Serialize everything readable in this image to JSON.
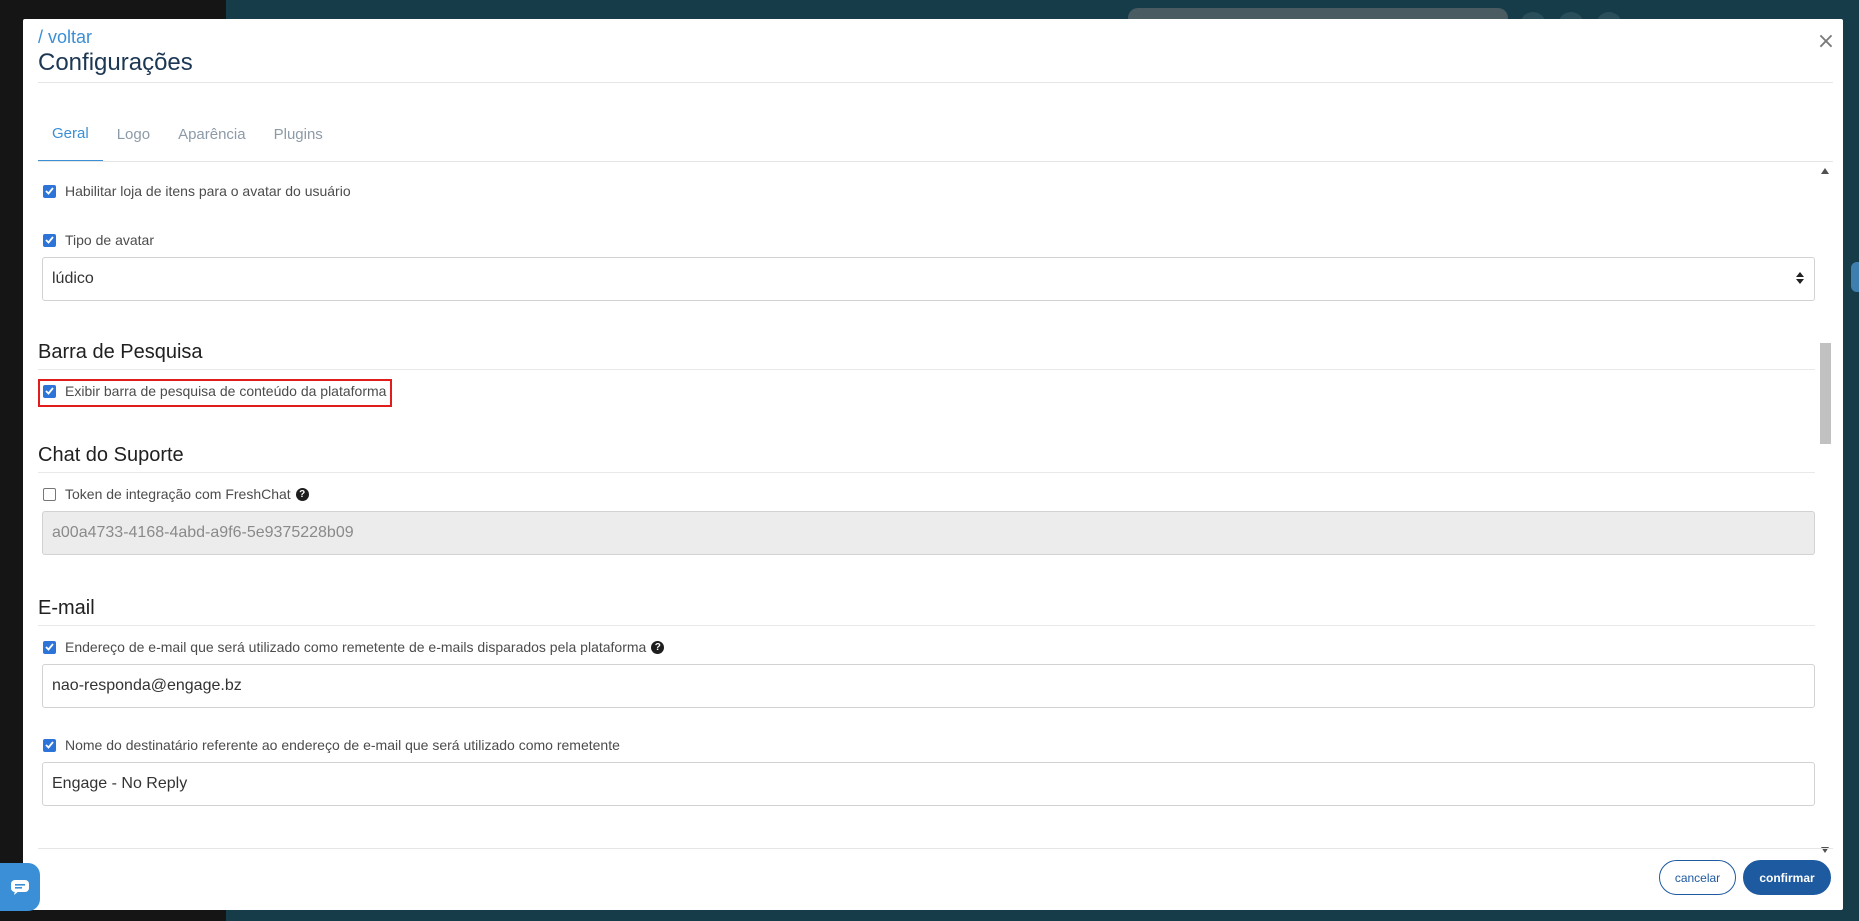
{
  "header": {
    "back_label": "/ voltar",
    "title": "Configurações",
    "close_icon": "×"
  },
  "tabs": [
    {
      "label": "Geral",
      "active": true
    },
    {
      "label": "Logo",
      "active": false
    },
    {
      "label": "Aparência",
      "active": false
    },
    {
      "label": "Plugins",
      "active": false
    }
  ],
  "general": {
    "avatar_store": {
      "label": "Habilitar loja de itens para o avatar do usuário",
      "checked": true
    },
    "avatar_type": {
      "label": "Tipo de avatar",
      "checked": true,
      "value": "lúdico"
    }
  },
  "search_bar": {
    "title": "Barra de Pesquisa",
    "show_search": {
      "label": "Exibir barra de pesquisa de conteúdo da plataforma",
      "checked": true
    }
  },
  "support_chat": {
    "title": "Chat do Suporte",
    "freshchat_token": {
      "label": "Token de integração com FreshChat",
      "checked": false,
      "placeholder": "a00a4733-4168-4abd-a9f6-5e9375228b09"
    }
  },
  "email": {
    "title": "E-mail",
    "sender_address": {
      "label": "Endereço de e-mail que será utilizado como remetente de e-mails disparados pela plataforma",
      "checked": true,
      "value": "nao-responda@engage.bz"
    },
    "sender_name": {
      "label": "Nome do destinatário referente ao endereço de e-mail que será utilizado como remetente",
      "checked": true,
      "value": "Engage - No Reply"
    }
  },
  "footer": {
    "cancel_label": "cancelar",
    "confirm_label": "confirmar"
  },
  "colors": {
    "accent": "#3a8fd6",
    "primary_button": "#1e5aa0",
    "highlight": "#e01c1c",
    "backdrop": "#163c49"
  }
}
